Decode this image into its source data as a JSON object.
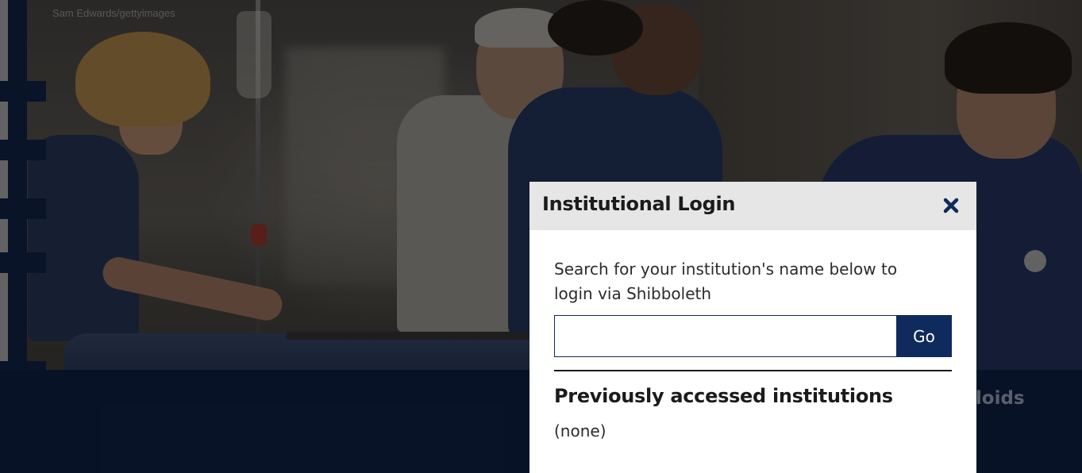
{
  "background": {
    "credit": "Sam Edwards/gettyimages",
    "banner_text": "lloids"
  },
  "modal": {
    "title": "Institutional Login",
    "close_icon": "close-icon",
    "instructions": "Search for your institution's name below to login via Shibboleth",
    "search": {
      "value": "",
      "placeholder": ""
    },
    "go_label": "Go",
    "previous_heading": "Previously accessed institutions",
    "previous_empty": "(none)"
  },
  "colors": {
    "accent": "#0f2a5c",
    "header_bg": "#e6e6e6",
    "banner_bg": "#0c1a36"
  }
}
